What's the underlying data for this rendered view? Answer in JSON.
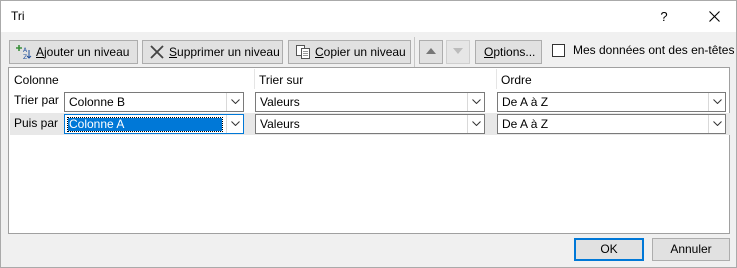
{
  "window": {
    "title": "Tri",
    "help_label": "?"
  },
  "toolbar": {
    "add_level": {
      "pre": "",
      "mnemonic": "A",
      "post": "jouter un niveau"
    },
    "delete_level": {
      "pre": "",
      "mnemonic": "S",
      "post": "upprimer un niveau"
    },
    "copy_level": {
      "pre": "",
      "mnemonic": "C",
      "post": "opier un niveau"
    },
    "options": {
      "pre": "",
      "mnemonic": "O",
      "post": "ptions..."
    },
    "headers_checkbox": {
      "label": "Mes données ont des en-têtes",
      "checked": false
    }
  },
  "grid": {
    "headers": {
      "column": "Colonne",
      "sort_on": "Trier sur",
      "order": "Ordre"
    },
    "rows": [
      {
        "label": "Trier par",
        "column": "Colonne B",
        "sort_on": "Valeurs",
        "order": "De A à Z"
      },
      {
        "label": "Puis par",
        "column": "Colonne A",
        "sort_on": "Valeurs",
        "order": "De A à Z"
      }
    ]
  },
  "footer": {
    "ok_label": "OK",
    "cancel_label": "Annuler"
  },
  "colors": {
    "accent": "#0078d7",
    "background": "#f0f0f0",
    "button": "#e1e1e1"
  }
}
